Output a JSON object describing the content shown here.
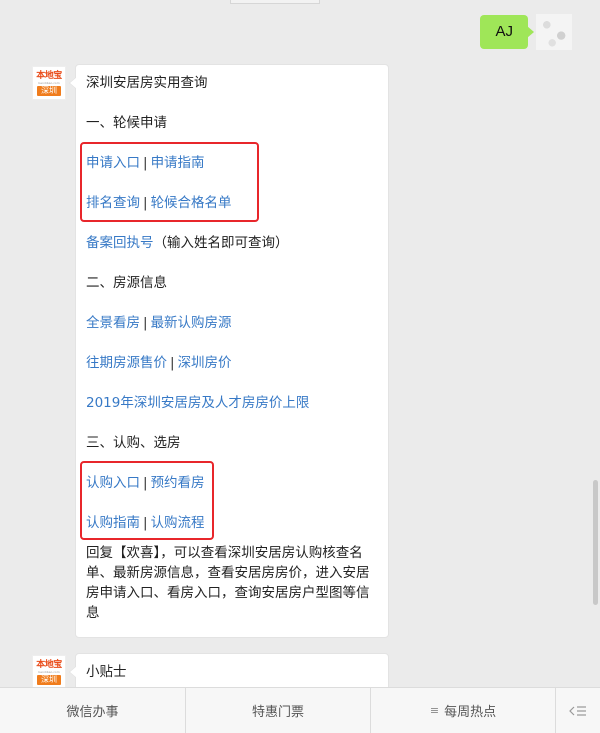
{
  "user_message": {
    "text": "AJ"
  },
  "bot": {
    "avatar": {
      "brand": "本地宝",
      "site": "bendibao.com",
      "city": "深圳"
    }
  },
  "message1": {
    "title": "深圳安居房实用查询",
    "section1_title": "一、轮候申请",
    "apply_entry": "申请入口",
    "apply_guide": "申请指南",
    "rank_query": "排名查询",
    "qualified_list": "轮候合格名单",
    "receipt_number": "备案回执号",
    "receipt_hint": "（输入姓名即可查询）",
    "section2_title": "二、房源信息",
    "panorama": "全景看房",
    "latest_listing": "最新认购房源",
    "past_prices": "往期房源售价",
    "sz_prices": "深圳房价",
    "price_cap_2019": "2019年深圳安居房及人才房房价上限",
    "section3_title": "三、认购、选房",
    "purchase_entry": "认购入口",
    "book_viewing": "预约看房",
    "purchase_guide": "认购指南",
    "purchase_flow": "认购流程",
    "separator": "|",
    "reply_text": "回复【欢喜】，可以查看深圳安居房认购核查名单、最新房源信息，查看安居房房价，进入安居房申请入口、看房入口，查询安居房户型图等信息"
  },
  "message2": {
    "title": "小贴士"
  },
  "bottom_menu": [
    {
      "label": "微信办事",
      "icon": ""
    },
    {
      "label": "特惠门票",
      "icon": ""
    },
    {
      "label": "每周热点",
      "icon": "≡"
    }
  ],
  "keyboard_icon": "keyboard-toggle-icon",
  "colors": {
    "link": "#3779c6",
    "highlight": "#e8262b",
    "user_bubble": "#9fe658",
    "background": "#ebebeb"
  }
}
